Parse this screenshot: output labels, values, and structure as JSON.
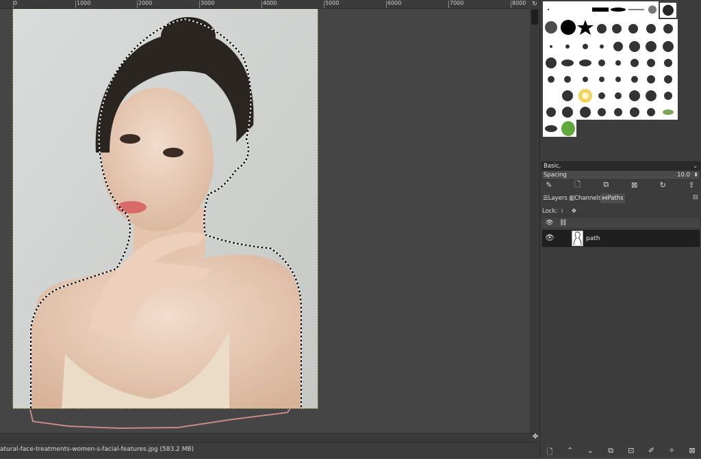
{
  "ruler": {
    "labels": [
      "0",
      "1000",
      "2000",
      "3000",
      "4000",
      "5000",
      "6000",
      "7000",
      "8000"
    ],
    "corner": "↻"
  },
  "status": {
    "filename": "atural-face-treatments-women-s-facial-features.jpg (583.2 MB)"
  },
  "brushes": {
    "preset": "Basic,",
    "spacing_label": "Spacing",
    "spacing_value": "10.0"
  },
  "tabs": {
    "layers": "Layers",
    "channels": "Channels",
    "paths": "Paths"
  },
  "lock_label": "Lock:",
  "path_item": {
    "name": "path"
  },
  "colors": {
    "selection": "#000000",
    "path_stroke": "#c98a8a",
    "canvas_border": "#d8d86a",
    "background": "#454545"
  }
}
